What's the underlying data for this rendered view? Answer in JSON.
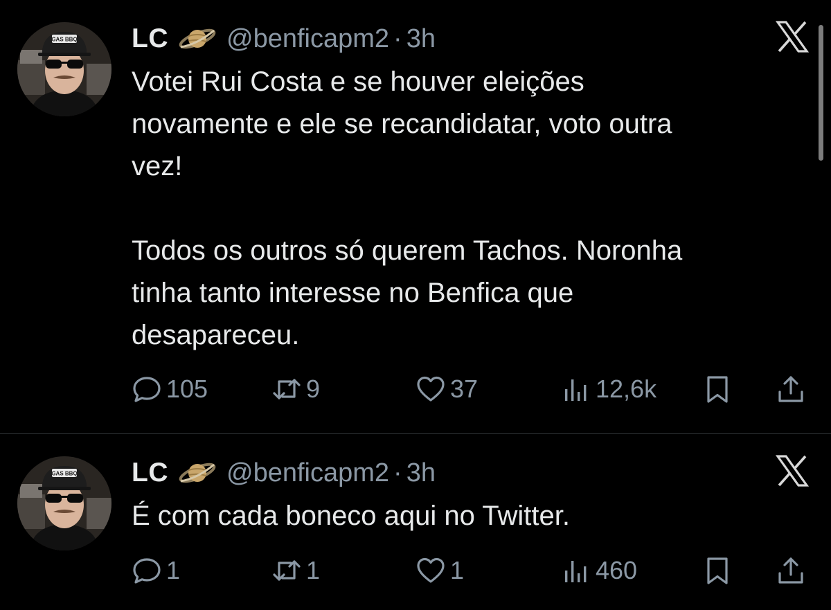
{
  "tweets": [
    {
      "author": {
        "name": "LC",
        "handle": "@benficapm2",
        "separator": "·",
        "time": "3h",
        "avatar_cap_text": "GAS BBQ"
      },
      "text": "Votei Rui Costa e se houver eleições\nnovamente e ele se recandidatar, voto outra\nvez!\n\nTodos os outros só querem Tachos. Noronha\ntinha tanto interesse no Benfica que\ndesapareceu.",
      "stats": {
        "replies": "105",
        "retweets": "9",
        "likes": "37",
        "views": "12,6k"
      }
    },
    {
      "author": {
        "name": "LC",
        "handle": "@benficapm2",
        "separator": "·",
        "time": "3h",
        "avatar_cap_text": "GAS BBQ"
      },
      "text": "É com cada boneco aqui no Twitter.",
      "stats": {
        "replies": "1",
        "retweets": "1",
        "likes": "1",
        "views": "460"
      }
    }
  ],
  "icons": {
    "badge": "saturn-planet-icon",
    "dismiss": "x-logo-icon",
    "reply": "speech-bubble-icon",
    "retweet": "retweet-arrows-icon",
    "like": "heart-icon",
    "views": "bar-chart-icon",
    "bookmark": "bookmark-icon",
    "share": "share-upload-icon"
  },
  "colors": {
    "background": "#000000",
    "text": "#e7e9ea",
    "secondary_text": "#8b98a5",
    "divider": "#2f3336"
  }
}
